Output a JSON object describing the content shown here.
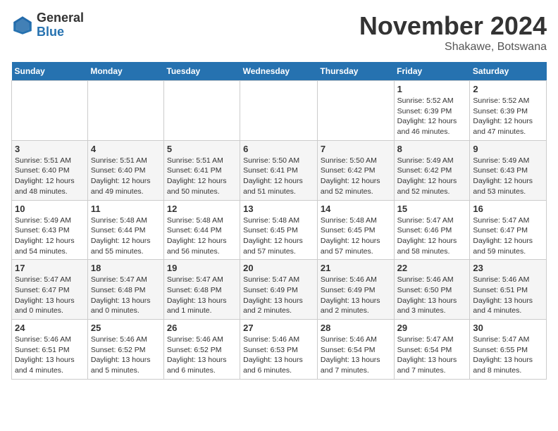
{
  "header": {
    "logo_general": "General",
    "logo_blue": "Blue",
    "month_title": "November 2024",
    "location": "Shakawe, Botswana"
  },
  "weekdays": [
    "Sunday",
    "Monday",
    "Tuesday",
    "Wednesday",
    "Thursday",
    "Friday",
    "Saturday"
  ],
  "weeks": [
    [
      {
        "day": "",
        "info": ""
      },
      {
        "day": "",
        "info": ""
      },
      {
        "day": "",
        "info": ""
      },
      {
        "day": "",
        "info": ""
      },
      {
        "day": "",
        "info": ""
      },
      {
        "day": "1",
        "info": "Sunrise: 5:52 AM\nSunset: 6:39 PM\nDaylight: 12 hours and 46 minutes."
      },
      {
        "day": "2",
        "info": "Sunrise: 5:52 AM\nSunset: 6:39 PM\nDaylight: 12 hours and 47 minutes."
      }
    ],
    [
      {
        "day": "3",
        "info": "Sunrise: 5:51 AM\nSunset: 6:40 PM\nDaylight: 12 hours and 48 minutes."
      },
      {
        "day": "4",
        "info": "Sunrise: 5:51 AM\nSunset: 6:40 PM\nDaylight: 12 hours and 49 minutes."
      },
      {
        "day": "5",
        "info": "Sunrise: 5:51 AM\nSunset: 6:41 PM\nDaylight: 12 hours and 50 minutes."
      },
      {
        "day": "6",
        "info": "Sunrise: 5:50 AM\nSunset: 6:41 PM\nDaylight: 12 hours and 51 minutes."
      },
      {
        "day": "7",
        "info": "Sunrise: 5:50 AM\nSunset: 6:42 PM\nDaylight: 12 hours and 52 minutes."
      },
      {
        "day": "8",
        "info": "Sunrise: 5:49 AM\nSunset: 6:42 PM\nDaylight: 12 hours and 52 minutes."
      },
      {
        "day": "9",
        "info": "Sunrise: 5:49 AM\nSunset: 6:43 PM\nDaylight: 12 hours and 53 minutes."
      }
    ],
    [
      {
        "day": "10",
        "info": "Sunrise: 5:49 AM\nSunset: 6:43 PM\nDaylight: 12 hours and 54 minutes."
      },
      {
        "day": "11",
        "info": "Sunrise: 5:48 AM\nSunset: 6:44 PM\nDaylight: 12 hours and 55 minutes."
      },
      {
        "day": "12",
        "info": "Sunrise: 5:48 AM\nSunset: 6:44 PM\nDaylight: 12 hours and 56 minutes."
      },
      {
        "day": "13",
        "info": "Sunrise: 5:48 AM\nSunset: 6:45 PM\nDaylight: 12 hours and 57 minutes."
      },
      {
        "day": "14",
        "info": "Sunrise: 5:48 AM\nSunset: 6:45 PM\nDaylight: 12 hours and 57 minutes."
      },
      {
        "day": "15",
        "info": "Sunrise: 5:47 AM\nSunset: 6:46 PM\nDaylight: 12 hours and 58 minutes."
      },
      {
        "day": "16",
        "info": "Sunrise: 5:47 AM\nSunset: 6:47 PM\nDaylight: 12 hours and 59 minutes."
      }
    ],
    [
      {
        "day": "17",
        "info": "Sunrise: 5:47 AM\nSunset: 6:47 PM\nDaylight: 13 hours and 0 minutes."
      },
      {
        "day": "18",
        "info": "Sunrise: 5:47 AM\nSunset: 6:48 PM\nDaylight: 13 hours and 0 minutes."
      },
      {
        "day": "19",
        "info": "Sunrise: 5:47 AM\nSunset: 6:48 PM\nDaylight: 13 hours and 1 minute."
      },
      {
        "day": "20",
        "info": "Sunrise: 5:47 AM\nSunset: 6:49 PM\nDaylight: 13 hours and 2 minutes."
      },
      {
        "day": "21",
        "info": "Sunrise: 5:46 AM\nSunset: 6:49 PM\nDaylight: 13 hours and 2 minutes."
      },
      {
        "day": "22",
        "info": "Sunrise: 5:46 AM\nSunset: 6:50 PM\nDaylight: 13 hours and 3 minutes."
      },
      {
        "day": "23",
        "info": "Sunrise: 5:46 AM\nSunset: 6:51 PM\nDaylight: 13 hours and 4 minutes."
      }
    ],
    [
      {
        "day": "24",
        "info": "Sunrise: 5:46 AM\nSunset: 6:51 PM\nDaylight: 13 hours and 4 minutes."
      },
      {
        "day": "25",
        "info": "Sunrise: 5:46 AM\nSunset: 6:52 PM\nDaylight: 13 hours and 5 minutes."
      },
      {
        "day": "26",
        "info": "Sunrise: 5:46 AM\nSunset: 6:52 PM\nDaylight: 13 hours and 6 minutes."
      },
      {
        "day": "27",
        "info": "Sunrise: 5:46 AM\nSunset: 6:53 PM\nDaylight: 13 hours and 6 minutes."
      },
      {
        "day": "28",
        "info": "Sunrise: 5:46 AM\nSunset: 6:54 PM\nDaylight: 13 hours and 7 minutes."
      },
      {
        "day": "29",
        "info": "Sunrise: 5:47 AM\nSunset: 6:54 PM\nDaylight: 13 hours and 7 minutes."
      },
      {
        "day": "30",
        "info": "Sunrise: 5:47 AM\nSunset: 6:55 PM\nDaylight: 13 hours and 8 minutes."
      }
    ]
  ]
}
